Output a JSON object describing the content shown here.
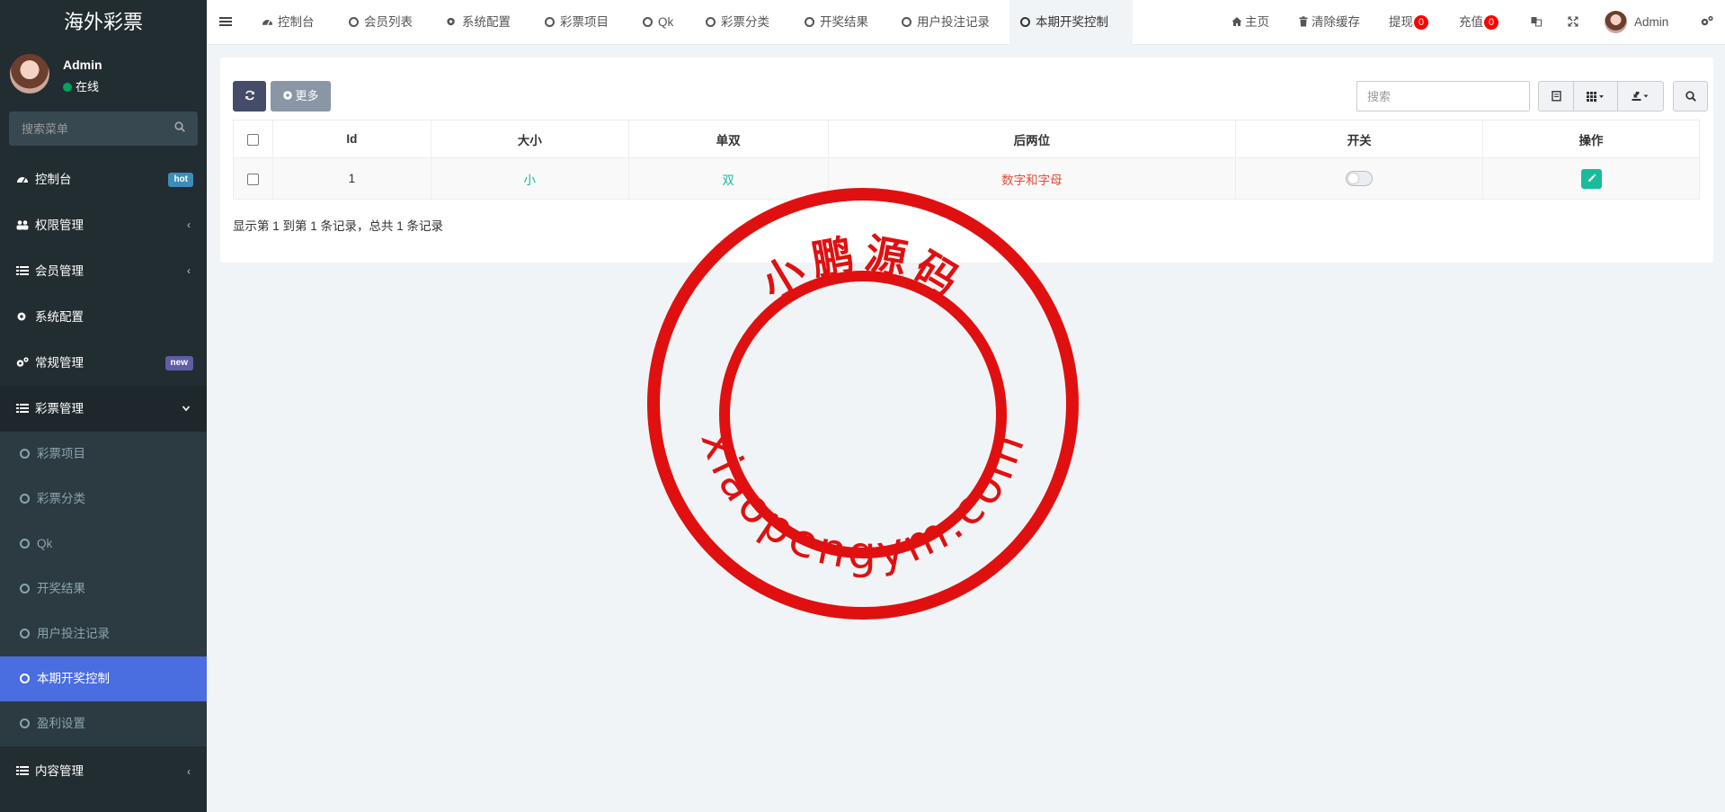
{
  "sidebar": {
    "brand": "海外彩票",
    "user": {
      "name": "Admin",
      "status": "在线"
    },
    "search_placeholder": "搜索菜单",
    "items": [
      {
        "label": "控制台",
        "icon": "dashboard-icon",
        "badge": "hot"
      },
      {
        "label": "权限管理",
        "icon": "users-icon"
      },
      {
        "label": "会员管理",
        "icon": "list-icon"
      },
      {
        "label": "系统配置",
        "icon": "gear-icon"
      },
      {
        "label": "常规管理",
        "icon": "gears-icon",
        "badge": "new"
      },
      {
        "label": "彩票管理",
        "icon": "list-icon"
      }
    ],
    "sub_items": [
      {
        "label": "彩票项目"
      },
      {
        "label": "彩票分类"
      },
      {
        "label": "Qk"
      },
      {
        "label": "开奖结果"
      },
      {
        "label": "用户投注记录"
      },
      {
        "label": "本期开奖控制",
        "active": true
      },
      {
        "label": "盈利设置"
      }
    ],
    "last_item": {
      "label": "内容管理",
      "icon": "list-icon"
    }
  },
  "topbar": {
    "tabs": [
      {
        "label": "控制台",
        "icon": "dashboard-icon"
      },
      {
        "label": "会员列表"
      },
      {
        "label": "系统配置",
        "icon": "gear-icon"
      },
      {
        "label": "彩票项目"
      },
      {
        "label": "Qk"
      },
      {
        "label": "彩票分类"
      },
      {
        "label": "开奖结果"
      },
      {
        "label": "用户投注记录"
      },
      {
        "label": "本期开奖控制",
        "active": true
      }
    ],
    "right": {
      "home": "主页",
      "clear_cache": "清除缓存",
      "withdraw": "提现",
      "withdraw_count": "0",
      "recharge": "充值",
      "recharge_count": "0",
      "user": "Admin"
    }
  },
  "toolbar": {
    "more_label": "更多",
    "search_placeholder": "搜索"
  },
  "table": {
    "columns": [
      "Id",
      "大小",
      "单双",
      "后两位",
      "开关",
      "操作"
    ],
    "rows": [
      {
        "id": "1",
        "size": "小",
        "parity": "双",
        "last_two": "数字和字母",
        "switch": false
      }
    ]
  },
  "pagination_info": "显示第 1 到第 1 条记录，总共 1 条记录",
  "watermark": {
    "top_text": "小鹏源码",
    "bottom_text": "xiaopengym.com",
    "color": "#e01010"
  },
  "colors": {
    "sidebar_bg": "#222d32",
    "active_item": "#4a6ee0",
    "accent_green": "#18bc9c",
    "accent_red": "#e74c3c"
  }
}
